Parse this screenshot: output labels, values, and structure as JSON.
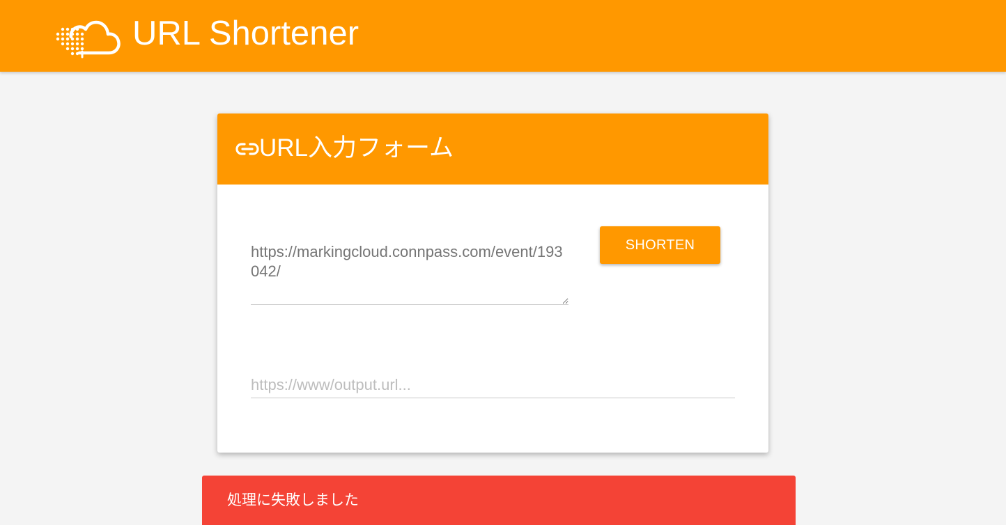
{
  "header": {
    "title": "URL Shortener",
    "logo_icon": "cloud-dots-logo-icon",
    "background_color": "#ff9800"
  },
  "card": {
    "title": "URL入力フォーム",
    "title_icon": "link-icon",
    "header_color": "#ff9800",
    "url_input": {
      "value": "https://markingcloud.connpass.com/event/193042/",
      "placeholder": ""
    },
    "shorten_button_label": "SHORTEN",
    "output_input": {
      "value": "",
      "placeholder": "https://www/output.url..."
    }
  },
  "error": {
    "message": "処理に失敗しました",
    "color": "#f44336"
  }
}
